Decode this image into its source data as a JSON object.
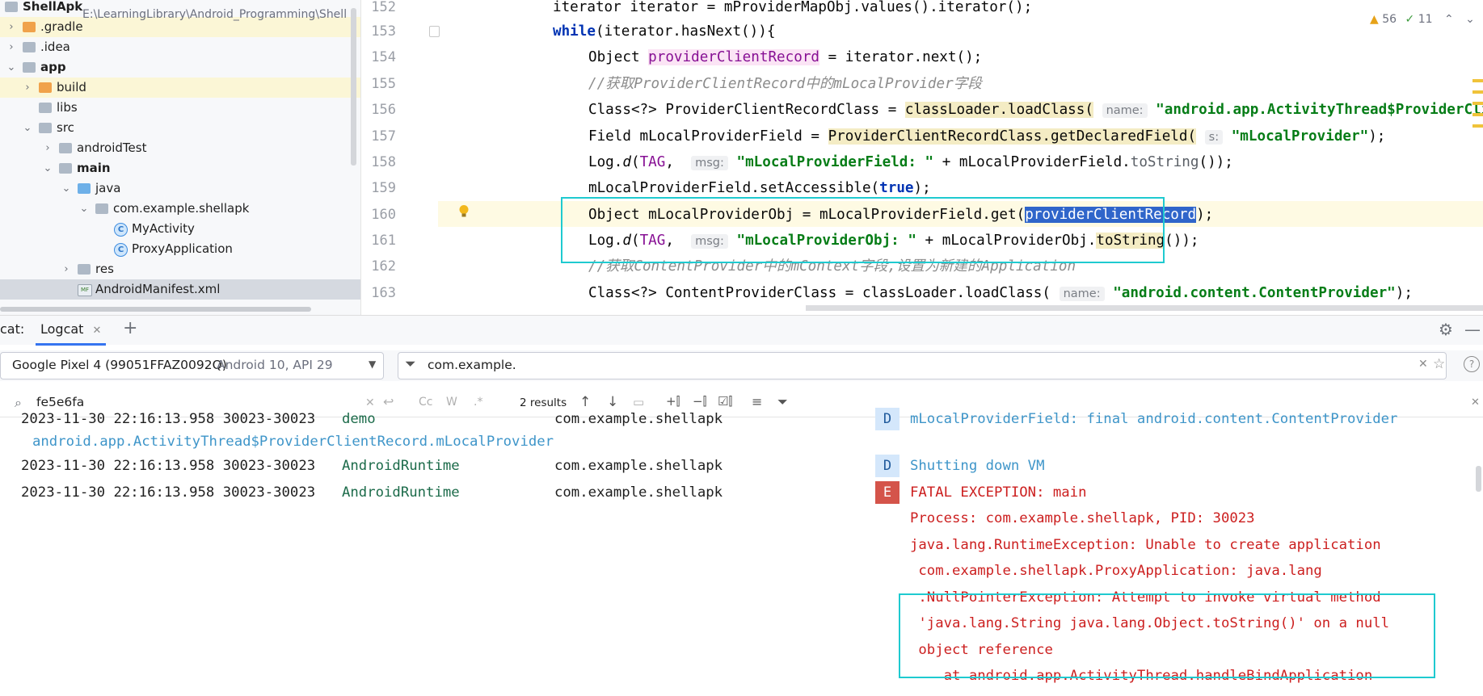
{
  "project": {
    "name": "ShellApk",
    "path": "E:\\LearningLibrary\\Android_Programming\\Shell",
    "tree": [
      {
        "label": "ShellApk",
        "indent": 0,
        "icon": "project-icon",
        "arrow": "",
        "bold": true
      },
      {
        "label": ".gradle",
        "indent": 1,
        "icon": "folder-orange-icon",
        "arrow": "›"
      },
      {
        "label": ".idea",
        "indent": 1,
        "icon": "folder-icon",
        "arrow": "›"
      },
      {
        "label": "app",
        "indent": 1,
        "icon": "module-icon",
        "arrow": "⌄",
        "bold": true
      },
      {
        "label": "build",
        "indent": 2,
        "icon": "folder-orange-icon",
        "arrow": "›"
      },
      {
        "label": "libs",
        "indent": 2,
        "icon": "folder-icon",
        "arrow": ""
      },
      {
        "label": "src",
        "indent": 2,
        "icon": "folder-icon",
        "arrow": "⌄"
      },
      {
        "label": "androidTest",
        "indent": 3,
        "icon": "folder-icon",
        "arrow": "›"
      },
      {
        "label": "main",
        "indent": 3,
        "icon": "folder-icon",
        "arrow": "⌄",
        "bold": true
      },
      {
        "label": "java",
        "indent": 4,
        "icon": "folder-blue-icon",
        "arrow": "⌄"
      },
      {
        "label": "com.example.shellapk",
        "indent": 5,
        "icon": "package-icon",
        "arrow": "⌄"
      },
      {
        "label": "MyActivity",
        "indent": 6,
        "icon": "class-icon",
        "arrow": ""
      },
      {
        "label": "ProxyApplication",
        "indent": 6,
        "icon": "class-icon",
        "arrow": ""
      },
      {
        "label": "res",
        "indent": 4,
        "icon": "folder-icon",
        "arrow": "›"
      },
      {
        "label": "AndroidManifest.xml",
        "indent": 4,
        "icon": "manifest-icon",
        "arrow": ""
      }
    ]
  },
  "editor": {
    "inspections": {
      "warnings": "56",
      "checks": "11"
    },
    "line_numbers": [
      "152",
      "153",
      "154",
      "155",
      "156",
      "157",
      "158",
      "159",
      "160",
      "161",
      "162",
      "163"
    ],
    "code": {
      "l152": "iterator iterator = mProviderMapObj.values().iterator();",
      "l153_kw": "while",
      "l153_rest": "(iterator.hasNext()){",
      "l154_a": "Object ",
      "l154_b": "providerClientRecord",
      "l154_c": " = iterator.next();",
      "l155": "//获取ProviderClientRecord中的mLocalProvider字段",
      "l156_a": "Class<?> ProviderClientRecordClass = ",
      "l156_b": "classLoader.loadClass(",
      "l156_hint": "name:",
      "l156_str": "\"android.app.ActivityThread$ProviderClientRecord\"",
      "l157_a": "Field mLocalProviderField = ",
      "l157_b": "ProviderClientRecordClass.getDeclaredField(",
      "l157_hint": "s:",
      "l157_str": "\"mLocalProvider\"",
      "l157_c": ");",
      "l158_a": "Log.",
      "l158_d": "d",
      "l158_b": "(",
      "l158_tag": "TAG",
      "l158_c": ", ",
      "l158_hint": "msg:",
      "l158_str": "\"mLocalProviderField: \"",
      "l158_e": " + mLocalProviderField.",
      "l158_f": "toString",
      "l158_g": "());",
      "l159_a": "mLocalProviderField.setAccessible(",
      "l159_kw": "true",
      "l159_b": ");",
      "l160_a": "Object mLocalProviderObj = mLocalProviderField.get(",
      "l160_sel": "providerClientRecord",
      "l160_b": ");",
      "l161_a": "Log.",
      "l161_d": "d",
      "l161_b": "(",
      "l161_tag": "TAG",
      "l161_c": ", ",
      "l161_hint": "msg:",
      "l161_str": "\"mLocalProviderObj: \"",
      "l161_e": " + mLocalProviderObj.",
      "l161_f": "toString",
      "l161_g": "());",
      "l162": "//获取ContentProvider中的mContext字段,设置为新建的Application",
      "l163_a": "Class<?> ContentProviderClass = classLoader.loadClass(",
      "l163_hint": "name:",
      "l163_str": "\"android.content.ContentProvider\"",
      "l163_b": ");"
    }
  },
  "logcat": {
    "title": "Logcat",
    "tab_prefix": "cat:",
    "tab_label": "Logcat",
    "device": "Google Pixel 4 (99051FFAZ0092Q)",
    "device_api": "Android 10, API 29",
    "filter": "com.example.",
    "search_value": "fe5e6fa",
    "search_toggles": [
      "Cc",
      "W",
      ".*"
    ],
    "results": "2 results",
    "rows": [
      {
        "ts": "2023-11-30 22:16:13.958 30023-30023",
        "tag": "demo",
        "pkg": "com.example.shellapk",
        "level": "D",
        "msg": "mLocalProviderField: final android.content.ContentProvider"
      },
      {
        "ts": "2023-11-30 22:16:13.958 30023-30023",
        "tag": "AndroidRuntime",
        "pkg": "com.example.shellapk",
        "level": "D",
        "msg": "Shutting down VM"
      },
      {
        "ts": "2023-11-30 22:16:13.958 30023-30023",
        "tag": "AndroidRuntime",
        "pkg": "com.example.shellapk",
        "level": "E",
        "msg": "FATAL EXCEPTION: main"
      }
    ],
    "row1_cont": "android.app.ActivityThread$ProviderClientRecord.mLocalProvider",
    "error_lines": [
      "Process: com.example.shellapk, PID: 30023",
      "java.lang.RuntimeException: Unable to create application",
      " com.example.shellapk.ProxyApplication: java.lang",
      " .NullPointerException: Attempt to invoke virtual method",
      " 'java.lang.String java.lang.Object.toString()' on a null",
      " object reference",
      "    at android.app.ActivityThread.handleBindApplication"
    ]
  }
}
